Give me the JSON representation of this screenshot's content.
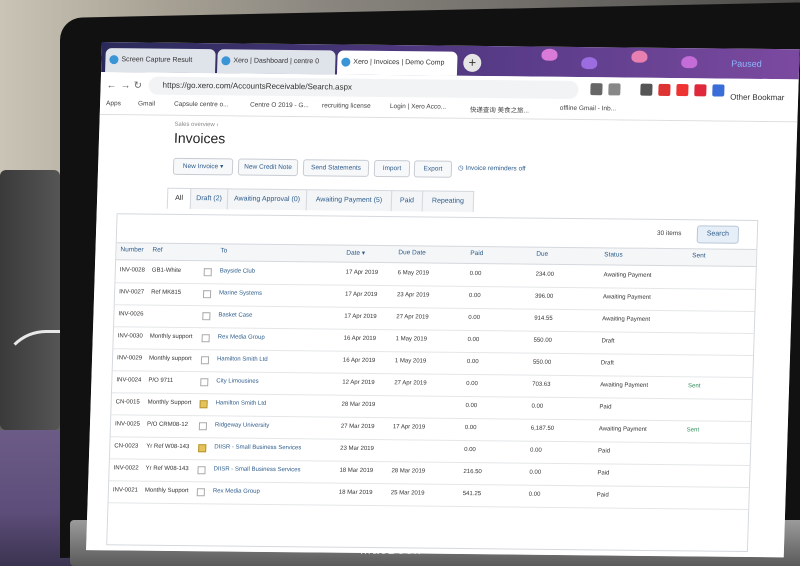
{
  "browser": {
    "tabs": [
      {
        "label": "Screen Capture Result",
        "active": false
      },
      {
        "label": "Xero | Dashboard | centre 0",
        "active": false
      },
      {
        "label": "Xero | Invoices | Demo Comp",
        "active": true
      }
    ],
    "new_tab": "+",
    "paused": "Paused",
    "url": "https://go.xero.com/AccountsReceivable/Search.aspx",
    "bookmarks": [
      "Apps",
      "Gmail",
      "Capsule centre o...",
      "Centre O 2019 - G...",
      "recruiting license",
      "Login | Xero Acco...",
      "快递查询 美食之旅...",
      "offline Gmail - Inb..."
    ],
    "other_bookmarks": "Other Bookmar"
  },
  "page": {
    "breadcrumb": "Sales overview ›",
    "title": "Invoices",
    "buttons": [
      "New Invoice",
      "New Credit Note",
      "Send Statements",
      "Import",
      "Export"
    ],
    "new_invoice_caret": "▾",
    "reminder": "Invoice reminders off",
    "tabs": [
      "All",
      "Draft (2)",
      "Awaiting Approval (0)",
      "Awaiting Payment (5)",
      "Paid",
      "Repeating"
    ],
    "count": "30 items",
    "search": "Search",
    "columns": [
      "Number",
      "Ref",
      "To",
      "Date ▾",
      "Due Date",
      "Paid",
      "Due",
      "Status",
      "Sent"
    ]
  },
  "rows": [
    {
      "number": "INV-0028",
      "ref": "GB1-White",
      "to": "Bayside Club",
      "date": "17 Apr 2019",
      "due_date": "6 May 2019",
      "paid": "0.00",
      "due": "234.00",
      "status": "Awaiting Payment",
      "sent": "",
      "att": false
    },
    {
      "number": "INV-0027",
      "ref": "Ref MK815",
      "to": "Marine Systems",
      "date": "17 Apr 2019",
      "due_date": "23 Apr 2019",
      "paid": "0.00",
      "due": "396.00",
      "status": "Awaiting Payment",
      "sent": "",
      "att": false
    },
    {
      "number": "INV-0026",
      "ref": "",
      "to": "Basket Case",
      "date": "17 Apr 2019",
      "due_date": "27 Apr 2019",
      "paid": "0.00",
      "due": "914.55",
      "status": "Awaiting Payment",
      "sent": "",
      "att": false
    },
    {
      "number": "INV-0030",
      "ref": "Monthly support",
      "to": "Rex Media Group",
      "date": "16 Apr 2019",
      "due_date": "1 May 2019",
      "paid": "0.00",
      "due": "550.00",
      "status": "Draft",
      "sent": "",
      "att": false
    },
    {
      "number": "INV-0029",
      "ref": "Monthly support",
      "to": "Hamilton Smith Ltd",
      "date": "16 Apr 2019",
      "due_date": "1 May 2019",
      "paid": "0.00",
      "due": "550.00",
      "status": "Draft",
      "sent": "",
      "att": false
    },
    {
      "number": "INV-0024",
      "ref": "P/O 9711",
      "to": "City Limousines",
      "date": "12 Apr 2019",
      "due_date": "27 Apr 2019",
      "paid": "0.00",
      "due": "703.63",
      "status": "Awaiting Payment",
      "sent": "Sent",
      "att": false
    },
    {
      "number": "CN-0015",
      "ref": "Monthly Support",
      "to": "Hamilton Smith Ltd",
      "date": "28 Mar 2019",
      "due_date": "",
      "paid": "0.00",
      "due": "0.00",
      "status": "Paid",
      "sent": "",
      "att": true
    },
    {
      "number": "INV-0025",
      "ref": "P/O CRM08-12",
      "to": "Ridgeway University",
      "date": "27 Mar 2019",
      "due_date": "17 Apr 2019",
      "paid": "0.00",
      "due": "6,187.50",
      "status": "Awaiting Payment",
      "sent": "Sent",
      "att": false
    },
    {
      "number": "CN-0023",
      "ref": "Yr Ref W08-143",
      "to": "DIISR - Small Business Services",
      "date": "23 Mar 2019",
      "due_date": "",
      "paid": "0.00",
      "due": "0.00",
      "status": "Paid",
      "sent": "",
      "att": true
    },
    {
      "number": "INV-0022",
      "ref": "Yr Ref W08-143",
      "to": "DIISR - Small Business Services",
      "date": "18 Mar 2019",
      "due_date": "28 Mar 2019",
      "paid": "216.50",
      "due": "0.00",
      "status": "Paid",
      "sent": "",
      "att": false
    },
    {
      "number": "INV-0021",
      "ref": "Monthly Support",
      "to": "Rex Media Group",
      "date": "18 Mar 2019",
      "due_date": "25 Mar 2019",
      "paid": "541.25",
      "due": "0.00",
      "status": "Paid",
      "sent": "",
      "att": false
    }
  ],
  "laptop_brand": "MacBook"
}
